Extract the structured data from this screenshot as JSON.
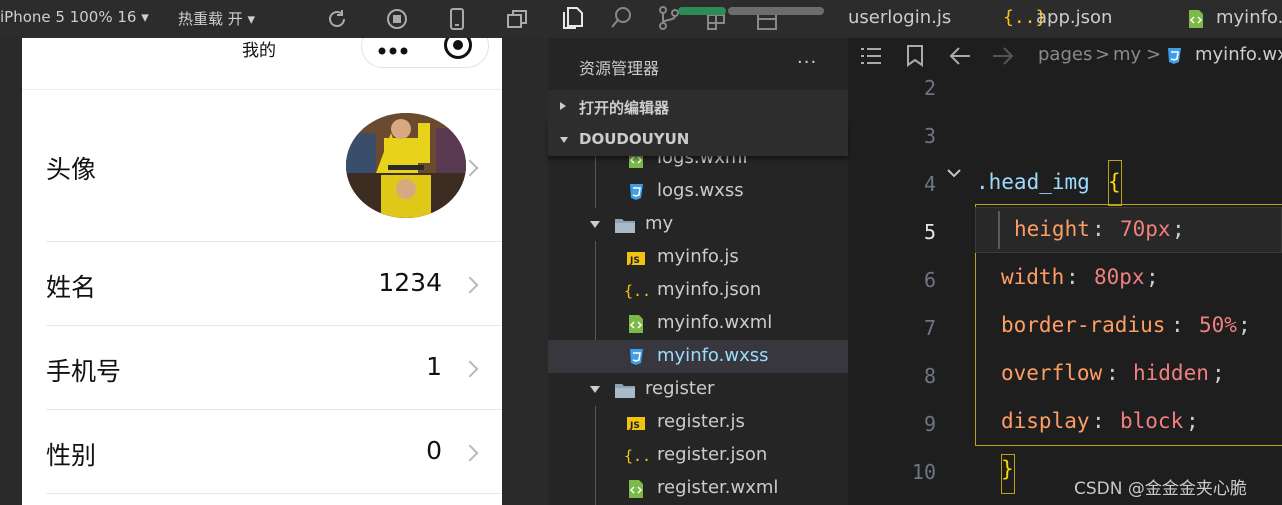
{
  "simulator_toolbar": {
    "device": "iPhone 5 100% 16 ▾",
    "hot_reload": "热重载 开 ▾"
  },
  "phone": {
    "nav_title": "我的",
    "rows": [
      {
        "label": "头像",
        "value": ""
      },
      {
        "label": "姓名",
        "value": "1234"
      },
      {
        "label": "手机号",
        "value": "1"
      },
      {
        "label": "性别",
        "value": "0"
      }
    ]
  },
  "explorer": {
    "title": "资源管理器",
    "more": "···",
    "section_open_editors": "打开的编辑器",
    "section_root": "DOUDOUYUN",
    "items": [
      {
        "name": "logs.wxml",
        "type": "wxml"
      },
      {
        "name": "logs.wxss",
        "type": "wxss"
      },
      {
        "name": "my",
        "type": "folder"
      },
      {
        "name": "myinfo.js",
        "type": "js"
      },
      {
        "name": "myinfo.json",
        "type": "json"
      },
      {
        "name": "myinfo.wxml",
        "type": "wxml"
      },
      {
        "name": "myinfo.wxss",
        "type": "wxss"
      },
      {
        "name": "register",
        "type": "folder"
      },
      {
        "name": "register.js",
        "type": "js"
      },
      {
        "name": "register.json",
        "type": "json"
      },
      {
        "name": "register.wxml",
        "type": "wxml"
      }
    ]
  },
  "tabs": [
    {
      "label": "userlogin.js"
    },
    {
      "label": "app.json"
    },
    {
      "label": "myinfo.wx"
    }
  ],
  "breadcrumbs": {
    "pages": "pages",
    "sep": ">",
    "my": "my",
    "file": "myinfo.wx"
  },
  "editor": {
    "line_numbers": [
      "2",
      "3",
      "4",
      "5",
      "6",
      "7",
      "8",
      "9",
      "10"
    ],
    "active_line": "5",
    "selector": ".head_img",
    "open_brace": "{",
    "close_brace": "}",
    "declarations": [
      {
        "prop": "height",
        "value": "70px"
      },
      {
        "prop": "width",
        "value": "80px"
      },
      {
        "prop": "border-radius",
        "value": "50%"
      },
      {
        "prop": "overflow",
        "value": "hidden"
      },
      {
        "prop": "display",
        "value": "block"
      }
    ]
  },
  "watermark": "CSDN @金金金夹心脆",
  "colors": {
    "selector": "#9cdcfe",
    "brace": "#ffd700",
    "property": "#ff9e64",
    "value": "#f08080",
    "js_icon": "#f1c40f",
    "wxss_icon": "#3c9fe8",
    "wxml_icon": "#7cba48",
    "json_icon": "#f5c518"
  },
  "icons": [
    "rotate-icon",
    "stop-icon",
    "phone-icon",
    "window-icon",
    "files-icon",
    "search-icon",
    "branch-icon",
    "extensions-icon",
    "list-icon",
    "bookmark-icon",
    "back-icon",
    "forward-icon"
  ]
}
